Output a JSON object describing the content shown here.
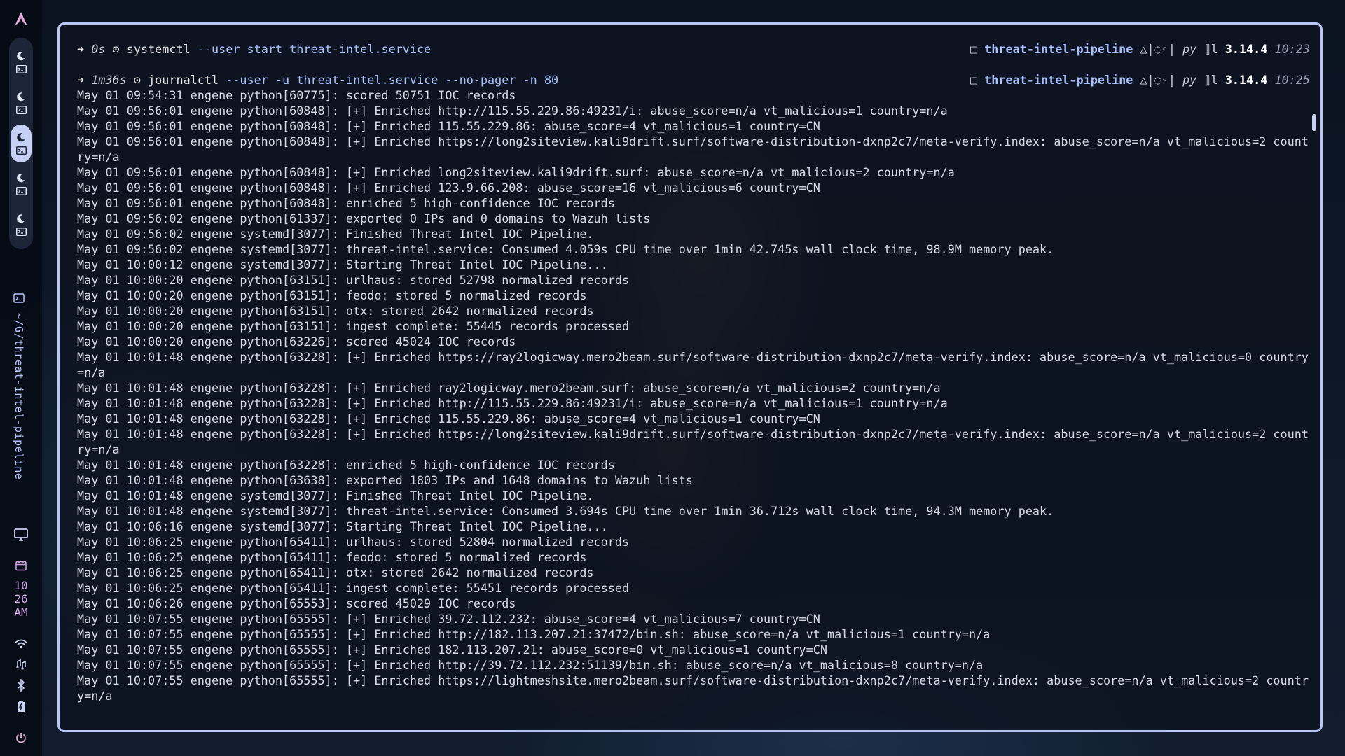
{
  "desktop": {
    "window_title": "~/G/threat-intel-pipeline",
    "clock": {
      "hour": "10",
      "minute": "26",
      "ampm": "AM"
    },
    "workspace_count": 5,
    "active_workspace": 3
  },
  "terminal": {
    "prompts": [
      {
        "arrow": "➜",
        "duration": "0s",
        "sep": "⊙",
        "command": "systemctl",
        "args": " --user start threat-intel.service",
        "box": "□",
        "project": "threat-intel-pipeline",
        "git": "△|◌◦|",
        "lang": "py",
        "lang_sep": "⟧l",
        "version": "3.14.4",
        "time": "10:23"
      },
      {
        "arrow": "➜",
        "duration": "1m36s",
        "sep": "⊙",
        "command": "journalctl",
        "args": " --user -u threat-intel.service --no-pager -n 80",
        "box": "□",
        "project": "threat-intel-pipeline",
        "git": "△|◌◦|",
        "lang": "py",
        "lang_sep": "⟧l",
        "version": "3.14.4",
        "time": "10:25"
      }
    ],
    "log_lines": [
      "May 01 09:54:31 engene python[60775]: scored 50751 IOC records",
      "May 01 09:56:01 engene python[60848]: [+] Enriched http://115.55.229.86:49231/i: abuse_score=n/a vt_malicious=1 country=n/a",
      "May 01 09:56:01 engene python[60848]: [+] Enriched 115.55.229.86: abuse_score=4 vt_malicious=1 country=CN",
      "May 01 09:56:01 engene python[60848]: [+] Enriched https://long2siteview.kali9drift.surf/software-distribution-dxnp2c7/meta-verify.index: abuse_score=n/a vt_malicious=2 country=n/a",
      "May 01 09:56:01 engene python[60848]: [+] Enriched long2siteview.kali9drift.surf: abuse_score=n/a vt_malicious=2 country=n/a",
      "May 01 09:56:01 engene python[60848]: [+] Enriched 123.9.66.208: abuse_score=16 vt_malicious=6 country=CN",
      "May 01 09:56:01 engene python[60848]: enriched 5 high-confidence IOC records",
      "May 01 09:56:02 engene python[61337]: exported 0 IPs and 0 domains to Wazuh lists",
      "May 01 09:56:02 engene systemd[3077]: Finished Threat Intel IOC Pipeline.",
      "May 01 09:56:02 engene systemd[3077]: threat-intel.service: Consumed 4.059s CPU time over 1min 42.745s wall clock time, 98.9M memory peak.",
      "May 01 10:00:12 engene systemd[3077]: Starting Threat Intel IOC Pipeline...",
      "May 01 10:00:20 engene python[63151]: urlhaus: stored 52798 normalized records",
      "May 01 10:00:20 engene python[63151]: feodo: stored 5 normalized records",
      "May 01 10:00:20 engene python[63151]: otx: stored 2642 normalized records",
      "May 01 10:00:20 engene python[63151]: ingest complete: 55445 records processed",
      "May 01 10:00:20 engene python[63226]: scored 45024 IOC records",
      "May 01 10:01:48 engene python[63228]: [+] Enriched https://ray2logicway.mero2beam.surf/software-distribution-dxnp2c7/meta-verify.index: abuse_score=n/a vt_malicious=0 country=n/a",
      "May 01 10:01:48 engene python[63228]: [+] Enriched ray2logicway.mero2beam.surf: abuse_score=n/a vt_malicious=2 country=n/a",
      "May 01 10:01:48 engene python[63228]: [+] Enriched http://115.55.229.86:49231/i: abuse_score=n/a vt_malicious=1 country=n/a",
      "May 01 10:01:48 engene python[63228]: [+] Enriched 115.55.229.86: abuse_score=4 vt_malicious=1 country=CN",
      "May 01 10:01:48 engene python[63228]: [+] Enriched https://long2siteview.kali9drift.surf/software-distribution-dxnp2c7/meta-verify.index: abuse_score=n/a vt_malicious=2 country=n/a",
      "May 01 10:01:48 engene python[63228]: enriched 5 high-confidence IOC records",
      "May 01 10:01:48 engene python[63638]: exported 1803 IPs and 1648 domains to Wazuh lists",
      "May 01 10:01:48 engene systemd[3077]: Finished Threat Intel IOC Pipeline.",
      "May 01 10:01:48 engene systemd[3077]: threat-intel.service: Consumed 3.694s CPU time over 1min 36.712s wall clock time, 94.3M memory peak.",
      "May 01 10:06:16 engene systemd[3077]: Starting Threat Intel IOC Pipeline...",
      "May 01 10:06:25 engene python[65411]: urlhaus: stored 52804 normalized records",
      "May 01 10:06:25 engene python[65411]: feodo: stored 5 normalized records",
      "May 01 10:06:25 engene python[65411]: otx: stored 2642 normalized records",
      "May 01 10:06:25 engene python[65411]: ingest complete: 55451 records processed",
      "May 01 10:06:26 engene python[65553]: scored 45029 IOC records",
      "May 01 10:07:55 engene python[65555]: [+] Enriched 39.72.112.232: abuse_score=4 vt_malicious=7 country=CN",
      "May 01 10:07:55 engene python[65555]: [+] Enriched http://182.113.207.21:37472/bin.sh: abuse_score=n/a vt_malicious=1 country=n/a",
      "May 01 10:07:55 engene python[65555]: [+] Enriched 182.113.207.21: abuse_score=0 vt_malicious=1 country=CN",
      "May 01 10:07:55 engene python[65555]: [+] Enriched http://39.72.112.232:51139/bin.sh: abuse_score=n/a vt_malicious=8 country=n/a",
      "May 01 10:07:55 engene python[65555]: [+] Enriched https://lightmeshsite.mero2beam.surf/software-distribution-dxnp2c7/meta-verify.index: abuse_score=n/a vt_malicious=2 country=n/a"
    ]
  },
  "icons": {
    "logo": "arch-logo-icon",
    "workspace_app": "moon-icon",
    "workspace_term": "terminal-icon",
    "monitor": "monitor-icon",
    "calendar": "calendar-icon",
    "wifi": "wifi-icon",
    "audio": "audio-icon",
    "bluetooth": "bluetooth-icon",
    "battery": "battery-icon",
    "power": "power-icon"
  },
  "colors": {
    "accent": "#b9c6f7",
    "clock": "#d8a8e8",
    "path": "#a9c1ff"
  }
}
